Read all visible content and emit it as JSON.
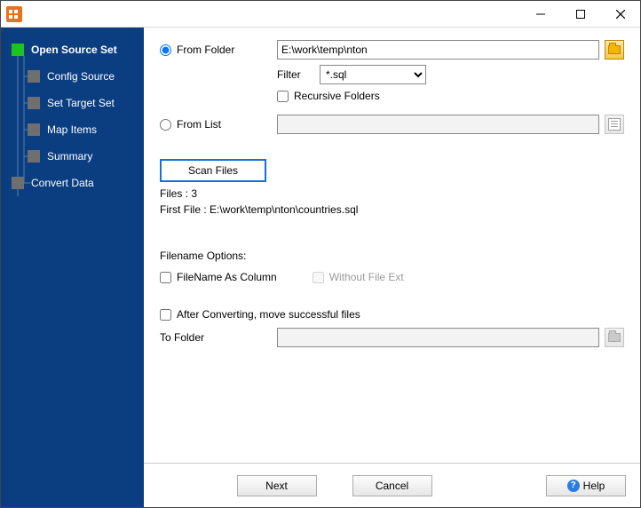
{
  "sidebar": {
    "items": [
      {
        "label": "Open Source Set"
      },
      {
        "label": "Config Source"
      },
      {
        "label": "Set Target Set"
      },
      {
        "label": "Map Items"
      },
      {
        "label": "Summary"
      },
      {
        "label": "Convert Data"
      }
    ]
  },
  "source": {
    "from_folder_label": "From Folder",
    "folder_path": "E:\\work\\temp\\nton",
    "filter_label": "Filter",
    "filter_value": "*.sql",
    "recursive_label": "Recursive Folders",
    "from_list_label": "From List",
    "list_path": ""
  },
  "scan": {
    "button": "Scan Files",
    "files_label": "Files : 3",
    "first_file_label": "First File : E:\\work\\temp\\nton\\countries.sql"
  },
  "filename_opts": {
    "header": "Filename Options:",
    "as_column": "FileName As Column",
    "without_ext": "Without File Ext"
  },
  "after": {
    "move_label": "After Converting, move successful files",
    "to_folder_label": "To Folder",
    "to_folder_path": ""
  },
  "footer": {
    "next": "Next",
    "cancel": "Cancel",
    "help": "Help"
  }
}
